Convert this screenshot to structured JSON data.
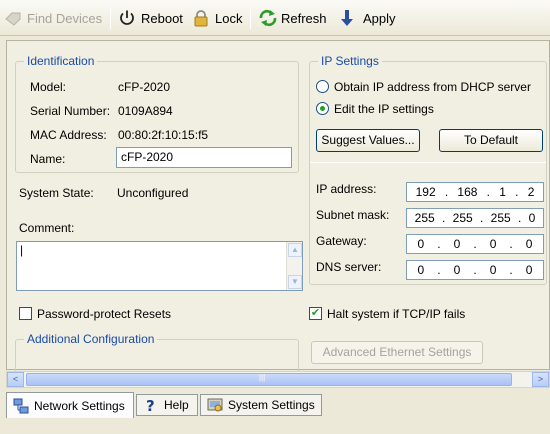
{
  "toolbar": {
    "find_devices": "Find Devices",
    "reboot": "Reboot",
    "lock": "Lock",
    "refresh": "Refresh",
    "apply": "Apply"
  },
  "identification": {
    "title": "Identification",
    "model_label": "Model:",
    "model_value": "cFP-2020",
    "serial_label": "Serial Number:",
    "serial_value": "0109A894",
    "mac_label": "MAC Address:",
    "mac_value": "00:80:2f:10:15:f5",
    "name_label": "Name:",
    "name_value": "cFP-2020"
  },
  "system_state": {
    "label": "System State:",
    "value": "Unconfigured"
  },
  "comment": {
    "label": "Comment:",
    "value": "|"
  },
  "password_protect": {
    "label": "Password-protect Resets",
    "checked": false
  },
  "additional_config": {
    "title": "Additional Configuration"
  },
  "ip_settings": {
    "title": "IP Settings",
    "dhcp_option": "Obtain IP address from DHCP server",
    "edit_option": "Edit the IP settings",
    "selected": "edit",
    "suggest_button": "Suggest Values...",
    "default_button": "To Default",
    "ip_label": "IP address:",
    "ip": [
      "192",
      "168",
      "1",
      "2"
    ],
    "subnet_label": "Subnet mask:",
    "subnet": [
      "255",
      "255",
      "255",
      "0"
    ],
    "gateway_label": "Gateway:",
    "gateway": [
      "0",
      "0",
      "0",
      "0"
    ],
    "dns_label": "DNS server:",
    "dns": [
      "0",
      "0",
      "0",
      "0"
    ],
    "dot": "."
  },
  "halt_system": {
    "label": "Halt system if TCP/IP fails",
    "checked": true
  },
  "advanced_button": "Advanced Ethernet Settings",
  "scrollbar": {
    "left": "<",
    "right": ">",
    "grip": "|||",
    "up": "▲",
    "down": "▼"
  },
  "tabs": [
    {
      "label": "Network Settings",
      "active": true
    },
    {
      "label": "Help",
      "active": false
    },
    {
      "label": "System Settings",
      "active": false
    }
  ],
  "colors": {
    "group_title": "#1a4ba5",
    "check_green": "#21a121",
    "accent_blue": "#3b5da8"
  },
  "icons": [
    "find-devices-icon",
    "reboot-icon",
    "lock-icon",
    "refresh-icon",
    "apply-icon",
    "network-icon",
    "help-icon",
    "system-icon"
  ]
}
